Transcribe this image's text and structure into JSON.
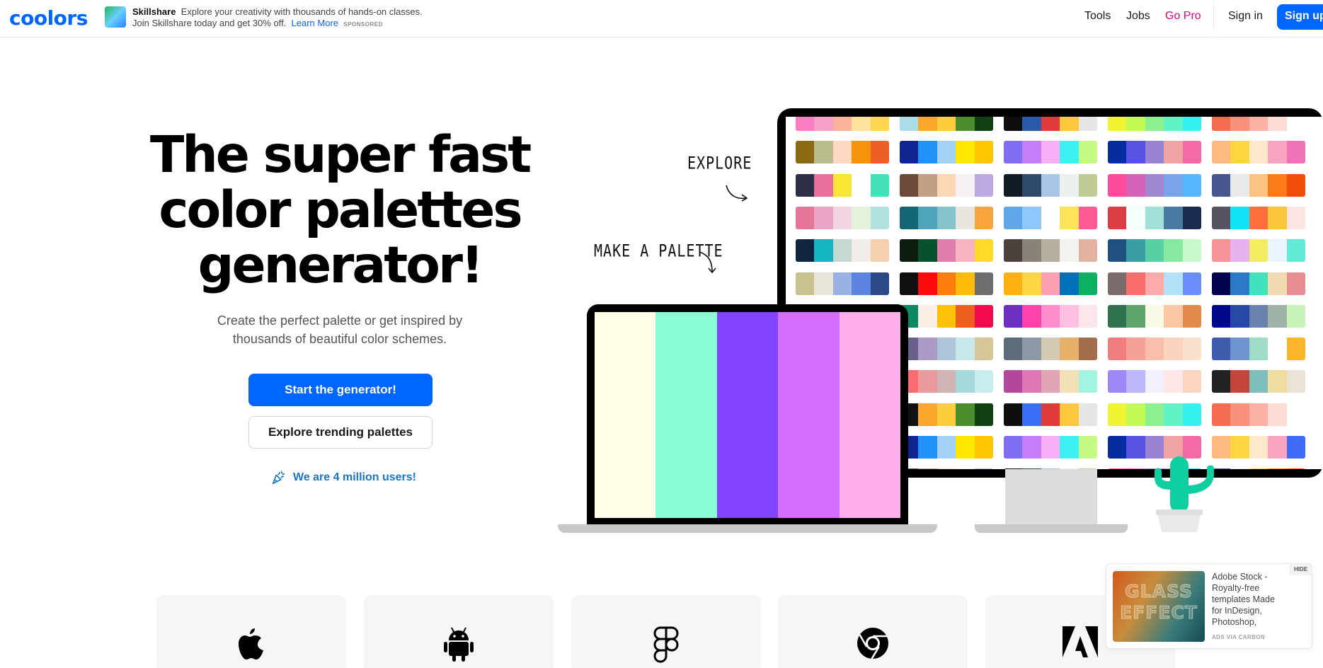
{
  "header": {
    "logo": "coolors",
    "ad": {
      "brand": "Skillshare",
      "text": "Explore your creativity with thousands of hands-on classes. Join Skillshare today and get 30% off.",
      "link": "Learn More",
      "tag": "SPONSORED"
    },
    "nav": {
      "tools": "Tools",
      "jobs": "Jobs",
      "go_pro": "Go Pro",
      "sign_in": "Sign in",
      "sign_up": "Sign up"
    }
  },
  "hero": {
    "title_line1": "The super fast",
    "title_line2": "color palettes",
    "title_line3": "generator!",
    "subtitle": "Create the perfect palette or get inspired by thousands of beautiful color schemes.",
    "start_button": "Start the generator!",
    "explore_button": "Explore trending palettes",
    "users": "We are 4 million users!"
  },
  "illustration": {
    "label_explore": "EXPLORE",
    "label_make": "MAKE A PALETTE",
    "laptop_palette": [
      "#fffde6",
      "#8afcd6",
      "#8344ff",
      "#d66fff",
      "#feaeea"
    ],
    "monitor_columns": [
      [
        [
          "#f97ec2",
          "#f9a0c9",
          "#fbb29a",
          "#fde39b",
          "#fdd54e"
        ],
        [
          "#8a6a12",
          "#b9bc8c",
          "#fed8c2",
          "#f7920d",
          "#ec5f28"
        ],
        [
          "#2c2f46",
          "#ea6f9c",
          "#f7e734",
          "#ffffff",
          "#43e1b7"
        ],
        [
          "#e57699",
          "#eba4c3",
          "#f2d4e2",
          "#e5f2da",
          "#b1e1df"
        ],
        [
          "#102540",
          "#12b7c1",
          "#c4d9d3",
          "#f0eee8",
          "#f5cfae"
        ],
        [
          "#c9c18e",
          "#e8e6d8",
          "#99b2e1",
          "#5a84df",
          "#2b4987"
        ],
        [
          "#19276d",
          "#6d82f3",
          "#fad3e7",
          "#ffffff",
          "#f4769a"
        ],
        [
          "#3d3b4b",
          "#6d6a82",
          "#a797c3",
          "#c4d2ef",
          "#fbfdff"
        ],
        [
          "#fe6e6a",
          "#e89a9a",
          "#d1b3b6",
          "#a8dcda",
          "#c9edef"
        ],
        [
          "#111111",
          "#fba72b",
          "#fdcd3e",
          "#4b8c2c",
          "#103f12"
        ],
        [
          "#0f2490",
          "#1f93f7",
          "#a2d1f6",
          "#ffe800",
          "#ffc700"
        ],
        [
          "#1f2a44",
          "#c49c83",
          "#f7d7b5",
          "#f6f0f3",
          "#c0a9e3"
        ]
      ],
      [
        [
          "#a9dde8",
          "#fba72b",
          "#fdcd3e",
          "#4b8c2c",
          "#103f12"
        ],
        [
          "#0f2490",
          "#1f93f7",
          "#a2d1f6",
          "#ffe800",
          "#ffc700"
        ],
        [
          "#6b4a39",
          "#c39f85",
          "#fbd7b5",
          "#f6f0f5",
          "#bba9e2"
        ],
        [
          "#146674",
          "#4fa4ba",
          "#85c2cb",
          "#e9e6e0",
          "#f8a53b"
        ],
        [
          "#0d1c0e",
          "#08512e",
          "#df7eaa",
          "#f6b4c3",
          "#fdd928"
        ],
        [
          "#0f0f0f",
          "#fd0a0a",
          "#fc7d0a",
          "#fcba0a",
          "#6d6d6d"
        ],
        [
          "#0a8a63",
          "#fbeee4",
          "#fcc209",
          "#ec601f",
          "#f10a4e"
        ],
        [
          "#6b5f8d",
          "#a99ac6",
          "#acc5d9",
          "#c7e8ea",
          "#d6c796"
        ],
        [
          "#fb6b6f",
          "#e99b9b",
          "#d1b3b6",
          "#a6d9d9",
          "#c9edef"
        ],
        [
          "#111111",
          "#fba72b",
          "#fdcd3e",
          "#4b8c2c",
          "#103f12"
        ],
        [
          "#0f2490",
          "#1f93f7",
          "#a2d1f6",
          "#ffe800",
          "#ffc700"
        ],
        [
          "#6b4a39",
          "#c39f85",
          "#fbd7b5",
          "#f6f0f5",
          "#bba9e2"
        ]
      ],
      [
        [
          "#0e0e0e",
          "#2a5aa8",
          "#e13a3a",
          "#fbc83b",
          "#e6e6e6"
        ],
        [
          "#7f6df2",
          "#c57df9",
          "#f7aef7",
          "#3ff0f3",
          "#c5fa85"
        ],
        [
          "#111b26",
          "#2d4a6b",
          "#a9c4e4",
          "#ecf1ee",
          "#bfcb95"
        ],
        [
          "#5fa7e8",
          "#8cc8fa",
          "#ffffff",
          "#fde35a",
          "#fe5a93"
        ],
        [
          "#4a413d",
          "#8a8179",
          "#b6ae9f",
          "#f3f2ee",
          "#e2b1a1"
        ],
        [
          "#fdb00f",
          "#fdd641",
          "#fd9fb3",
          "#0271b8",
          "#0ab162"
        ],
        [
          "#6c2fbf",
          "#fe42a9",
          "#fe8dce",
          "#ffbfe1",
          "#fbe6ea"
        ],
        [
          "#5c6c7b",
          "#8b99a6",
          "#d6c9b3",
          "#e8b16b",
          "#a26e4a"
        ],
        [
          "#b4479a",
          "#df77b4",
          "#e1a5b5",
          "#f1e0b6",
          "#a2f3e0"
        ],
        [
          "#0e0e0e",
          "#3a6ef6",
          "#e13a3a",
          "#fbc83b",
          "#e6e6e6"
        ],
        [
          "#7f6df2",
          "#c57df9",
          "#f7aef7",
          "#3ff0f3",
          "#c5fa85"
        ],
        [
          "#111b26",
          "#2d4a6b",
          "#a9c4e4",
          "#ecf1ee",
          "#bfcb95"
        ]
      ],
      [
        [
          "#f1f430",
          "#c1fa52",
          "#8cf08e",
          "#5ff3c5",
          "#34f2ef"
        ],
        [
          "#052d9f",
          "#5751e4",
          "#9b83d3",
          "#f2a3a3",
          "#f56aa6"
        ],
        [
          "#fe4c9d",
          "#d562b9",
          "#a088d1",
          "#7aa4ea",
          "#55b6fd"
        ],
        [
          "#dc3d44",
          "#f2fffa",
          "#a2e0da",
          "#4a7ca3",
          "#1b2b4f"
        ],
        [
          "#205080",
          "#3b9ea5",
          "#57d1a3",
          "#87e9a0",
          "#c7f9cc"
        ],
        [
          "#7b6c6b",
          "#fb6c6c",
          "#fdaaaa",
          "#b2e1f9",
          "#6a8ffc"
        ],
        [
          "#2f7250",
          "#5fa66c",
          "#fafbe6",
          "#fbc6a4",
          "#e38b4a"
        ],
        [
          "#f17d7e",
          "#f5a19a",
          "#f9bfae",
          "#fbd4c0",
          "#fbe1cd"
        ],
        [
          "#9e87f8",
          "#bbb7f9",
          "#f3f0fd",
          "#fde7e7",
          "#fcd5c0"
        ],
        [
          "#f1f430",
          "#c1fa52",
          "#8cf08e",
          "#5ff3c5",
          "#34f2ef"
        ],
        [
          "#052d9f",
          "#5751e4",
          "#9b83d3",
          "#f2a3a3",
          "#f56aa6"
        ],
        [
          "#fe4c9d",
          "#d562b9",
          "#a088d1",
          "#7aa4ea",
          "#55b6fd"
        ]
      ],
      [
        [
          "#f36c52",
          "#f9907c",
          "#fbb1a3",
          "#fddcd6",
          "#ffffff"
        ],
        [
          "#fdba80",
          "#fbd640",
          "#fde8cc",
          "#fba4c2",
          "#f272b8"
        ],
        [
          "#47568f",
          "#e8e9ea",
          "#fac381",
          "#fb7a1a",
          "#f14e0b"
        ],
        [
          "#555461",
          "#13e3f8",
          "#fe6f3b",
          "#fcc63a",
          "#fde4e4"
        ],
        [
          "#f49497",
          "#e6b2ee",
          "#f4ec63",
          "#e9f4ff",
          "#63ead6"
        ],
        [
          "#03034d",
          "#2d79c9",
          "#40e3bb",
          "#f2dbb3",
          "#e88e93"
        ],
        [
          "#02088c",
          "#2848a7",
          "#6a80ad",
          "#9fb2a8",
          "#c8f3b8"
        ],
        [
          "#3f5caf",
          "#6f95d1",
          "#9edcc5",
          "#ffffff",
          "#fbb52d"
        ],
        [
          "#222222",
          "#c4463a",
          "#7ebfbd",
          "#f0dc9e",
          "#ece3d7"
        ],
        [
          "#f36c52",
          "#f9907c",
          "#fbb1a3",
          "#fddcd6",
          "#ffffff"
        ],
        [
          "#fdba80",
          "#fbd640",
          "#fde8cc",
          "#fba4c2",
          "#3e6cf6"
        ],
        [
          "#47568f",
          "#e8e9ea",
          "#fac381",
          "#fb7a1a",
          "#f14e0b"
        ]
      ]
    ]
  },
  "platforms": [
    "apple-icon",
    "android-icon",
    "figma-icon",
    "chrome-icon",
    "adobe-icon"
  ],
  "carbon_ad": {
    "image_text": "GLASS EFFECT",
    "text": "Adobe Stock - Royalty-free templates Made for InDesign, Photoshop, Illustrator and more.",
    "via": "ADS VIA CARBON",
    "hide": "HIDE"
  },
  "colors": {
    "brand": "#0066ff",
    "go_pro": "#e6007e",
    "users_link": "#1976c8",
    "cactus": "#0fcfa0"
  }
}
